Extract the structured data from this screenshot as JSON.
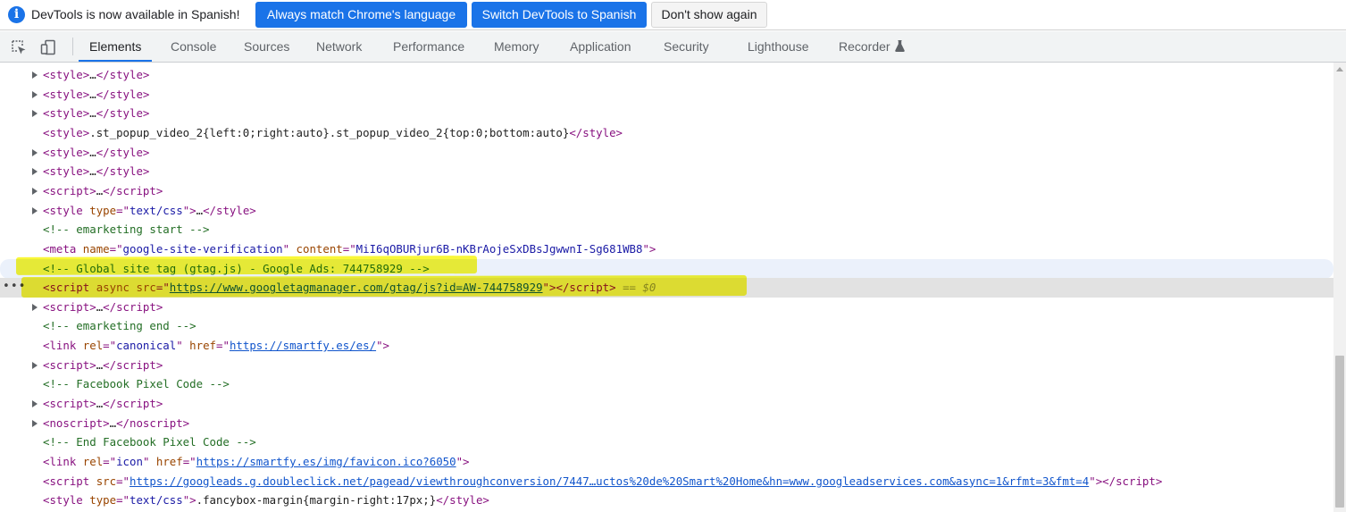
{
  "infobar": {
    "icon": "info-icon",
    "message": "DevTools is now available in Spanish!",
    "buttons": {
      "match_language": "Always match Chrome's language",
      "switch_spanish": "Switch DevTools to Spanish",
      "dont_show": "Don't show again"
    }
  },
  "toolbar": {
    "icons": [
      "inspect-element-icon",
      "device-toolbar-icon"
    ],
    "tabs": [
      "Elements",
      "Console",
      "Sources",
      "Network",
      "Performance",
      "Memory",
      "Application",
      "Security",
      "Lighthouse",
      "Recorder"
    ],
    "active_tab": "Elements",
    "recorder_badge_icon": "flask-icon"
  },
  "dom": {
    "selected_suffix": "== $0",
    "lines": [
      {
        "collapsed": true,
        "tag": "style"
      },
      {
        "collapsed": true,
        "tag": "style"
      },
      {
        "collapsed": true,
        "tag": "style"
      },
      {
        "tag": "style",
        "text": ".st_popup_video_2{left:0;right:auto}.st_popup_video_2{top:0;bottom:auto}"
      },
      {
        "collapsed": true,
        "tag": "style"
      },
      {
        "collapsed": true,
        "tag": "style"
      },
      {
        "collapsed": true,
        "tag": "script"
      },
      {
        "collapsed": true,
        "tag": "style",
        "attrs": [
          {
            "name": "type",
            "value": "text/css"
          }
        ]
      },
      {
        "comment": " emarketing start "
      },
      {
        "tag": "meta",
        "void": true,
        "attrs": [
          {
            "name": "name",
            "value": "google-site-verification"
          },
          {
            "name": "content",
            "value": "MiI6qOBURjur6B-nKBrAojeSxDBsJgwwnI-Sg681WB8"
          }
        ]
      },
      {
        "comment": " Global site tag (gtag.js) - Google Ads: 744758929 ",
        "hovered": true
      },
      {
        "tag": "script",
        "selected": true,
        "attrs": [
          {
            "name": "async",
            "value": null
          },
          {
            "name": "src",
            "value": "https://www.googletagmanager.com/gtag/js?id=AW-744758929",
            "link": true
          }
        ]
      },
      {
        "collapsed": true,
        "tag": "script"
      },
      {
        "comment": " emarketing end "
      },
      {
        "tag": "link",
        "void": true,
        "attrs": [
          {
            "name": "rel",
            "value": "canonical"
          },
          {
            "name": "href",
            "value": "https://smartfy.es/es/",
            "link": true
          }
        ]
      },
      {
        "collapsed": true,
        "tag": "script"
      },
      {
        "comment": " Facebook Pixel Code "
      },
      {
        "collapsed": true,
        "tag": "script"
      },
      {
        "collapsed": true,
        "tag": "noscript"
      },
      {
        "comment": " End Facebook Pixel Code "
      },
      {
        "tag": "link",
        "void": true,
        "attrs": [
          {
            "name": "rel",
            "value": "icon"
          },
          {
            "name": "href",
            "value": "https://smartfy.es/img/favicon.ico?6050",
            "link": true
          }
        ]
      },
      {
        "tag": "script",
        "attrs": [
          {
            "name": "src",
            "value": "https://googleads.g.doubleclick.net/pagead/viewthroughconversion/7447…uctos%20de%20Smart%20Home&hn=www.googleadservices.com&async=1&rfmt=3&fmt=4",
            "link": true
          }
        ]
      },
      {
        "tag": "style",
        "attrs": [
          {
            "name": "type",
            "value": "text/css"
          }
        ],
        "text": ".fancybox-margin{margin-right:17px;}"
      }
    ]
  },
  "colors": {
    "accent": "#1a73e8",
    "tag": "#881280",
    "attr_name": "#994500",
    "attr_value": "#1a1aa6",
    "comment": "#236e25",
    "highlighter": "#f7f500"
  }
}
